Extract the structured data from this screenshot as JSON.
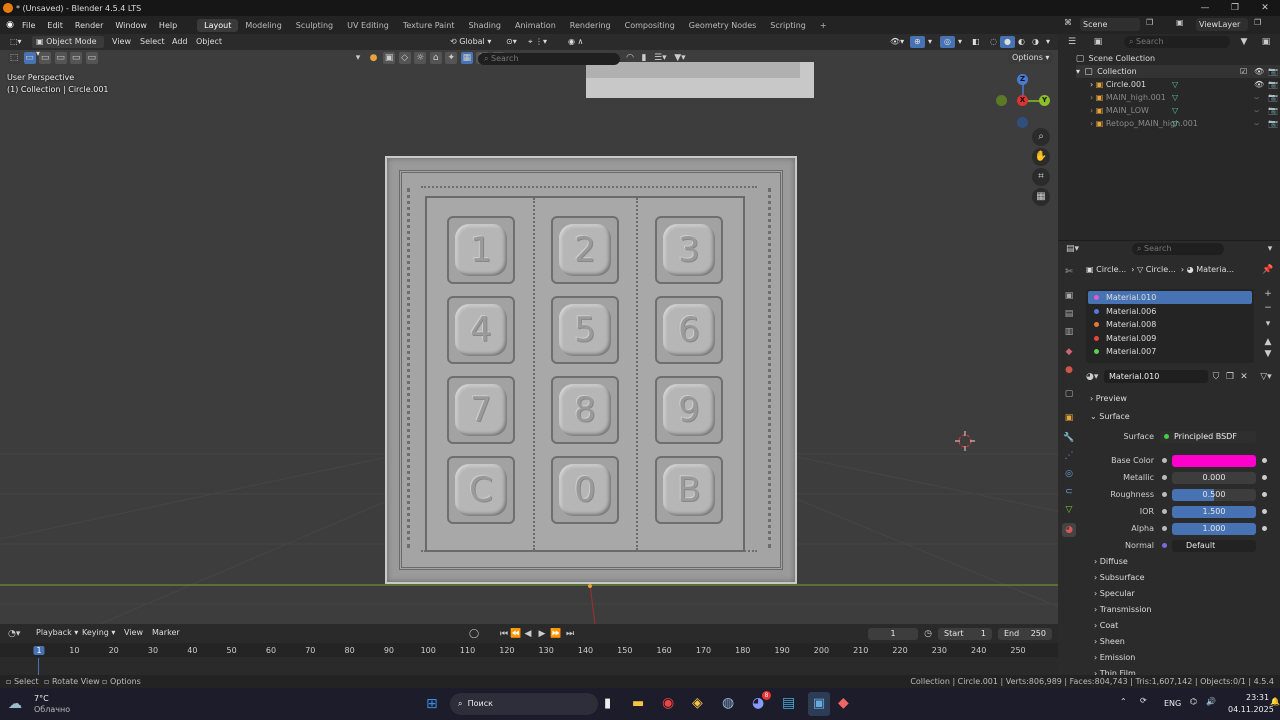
{
  "window": {
    "title": "* (Unsaved) - Blender 4.5.4 LTS",
    "minimize": "—",
    "restore": "❐",
    "close": "✕"
  },
  "menu": {
    "items": [
      "File",
      "Edit",
      "Render",
      "Window",
      "Help"
    ]
  },
  "workspaces": {
    "active": "Layout",
    "tabs": [
      "Layout",
      "Modeling",
      "Sculpting",
      "UV Editing",
      "Texture Paint",
      "Shading",
      "Animation",
      "Rendering",
      "Compositing",
      "Geometry Nodes",
      "Scripting"
    ],
    "add": "+"
  },
  "viewport": {
    "mode": "Object Mode",
    "menus": [
      "View",
      "Select",
      "Add",
      "Object"
    ],
    "transform_orientation": "Global",
    "search_placeholder": "Search",
    "options": "Options",
    "perspective": "User Perspective",
    "collection_info": "(1) Collection | Circle.001",
    "gizmo": {
      "z": "Z",
      "x": "X",
      "y": "Y"
    }
  },
  "keypad": {
    "keys": [
      "1",
      "2",
      "3",
      "4",
      "5",
      "6",
      "7",
      "8",
      "9",
      "C",
      "0",
      "B"
    ]
  },
  "top_right": {
    "scene": "Scene",
    "view_layer": "ViewLayer"
  },
  "outliner": {
    "search_placeholder": "Search",
    "root": "Scene Collection",
    "collection": "Collection",
    "objects": [
      {
        "name": "Circle.001",
        "active": true
      },
      {
        "name": "MAIN_high.001",
        "active": false
      },
      {
        "name": "MAIN_LOW",
        "active": false
      },
      {
        "name": "Retopo_MAIN_high.001",
        "active": false
      }
    ]
  },
  "properties": {
    "search_placeholder": "Search",
    "breadcrumb": [
      "Circle...",
      "Circle...",
      "Materia..."
    ],
    "materials": [
      {
        "name": "Material.010",
        "color": "#e05cc9",
        "selected": true
      },
      {
        "name": "Material.006",
        "color": "#4f7be0",
        "selected": false
      },
      {
        "name": "Material.008",
        "color": "#e07a3a",
        "selected": false
      },
      {
        "name": "Material.009",
        "color": "#e04a3a",
        "selected": false
      },
      {
        "name": "Material.007",
        "color": "#5bd14a",
        "selected": false
      }
    ],
    "active_material": "Material.010",
    "sections": {
      "preview": "Preview",
      "surface": "Surface"
    },
    "surface": {
      "label": "Surface",
      "value": "Principled BSDF"
    },
    "fields": [
      {
        "label": "Base Color",
        "value": "",
        "color": "#ff00cc",
        "fill": null
      },
      {
        "label": "Metallic",
        "value": "0.000",
        "fill": 0
      },
      {
        "label": "Roughness",
        "value": "0.500",
        "fill": 0.5
      },
      {
        "label": "IOR",
        "value": "1.500",
        "fill": 1
      },
      {
        "label": "Alpha",
        "value": "1.000",
        "fill": 1
      },
      {
        "label": "Normal",
        "value": "Default",
        "fill": null
      }
    ],
    "subpanels": [
      "Diffuse",
      "Subsurface",
      "Specular",
      "Transmission",
      "Coat",
      "Sheen",
      "Emission",
      "Thin Film"
    ]
  },
  "timeline": {
    "menus": [
      "Playback",
      "Keying",
      "View",
      "Marker"
    ],
    "current_frame": "1",
    "start_label": "Start",
    "start": "1",
    "end_label": "End",
    "end": "250",
    "ticks": [
      "1",
      "10",
      "20",
      "30",
      "40",
      "50",
      "60",
      "70",
      "80",
      "90",
      "100",
      "110",
      "120",
      "130",
      "140",
      "150",
      "160",
      "170",
      "180",
      "190",
      "200",
      "210",
      "220",
      "230",
      "240",
      "250"
    ]
  },
  "statusbar": {
    "select": "Select",
    "rotate": "Rotate View",
    "options": "Options",
    "info": "Collection | Circle.001 | Verts:806,989 | Faces:804,743 | Tris:1,607,142 | Objects:0/1 | 4.5.4"
  },
  "taskbar": {
    "temp": "7°C",
    "weather": "Облачно",
    "search": "Поиск",
    "lang": "ENG",
    "time": "23:31",
    "date": "04.11.2025",
    "badge": "8"
  }
}
